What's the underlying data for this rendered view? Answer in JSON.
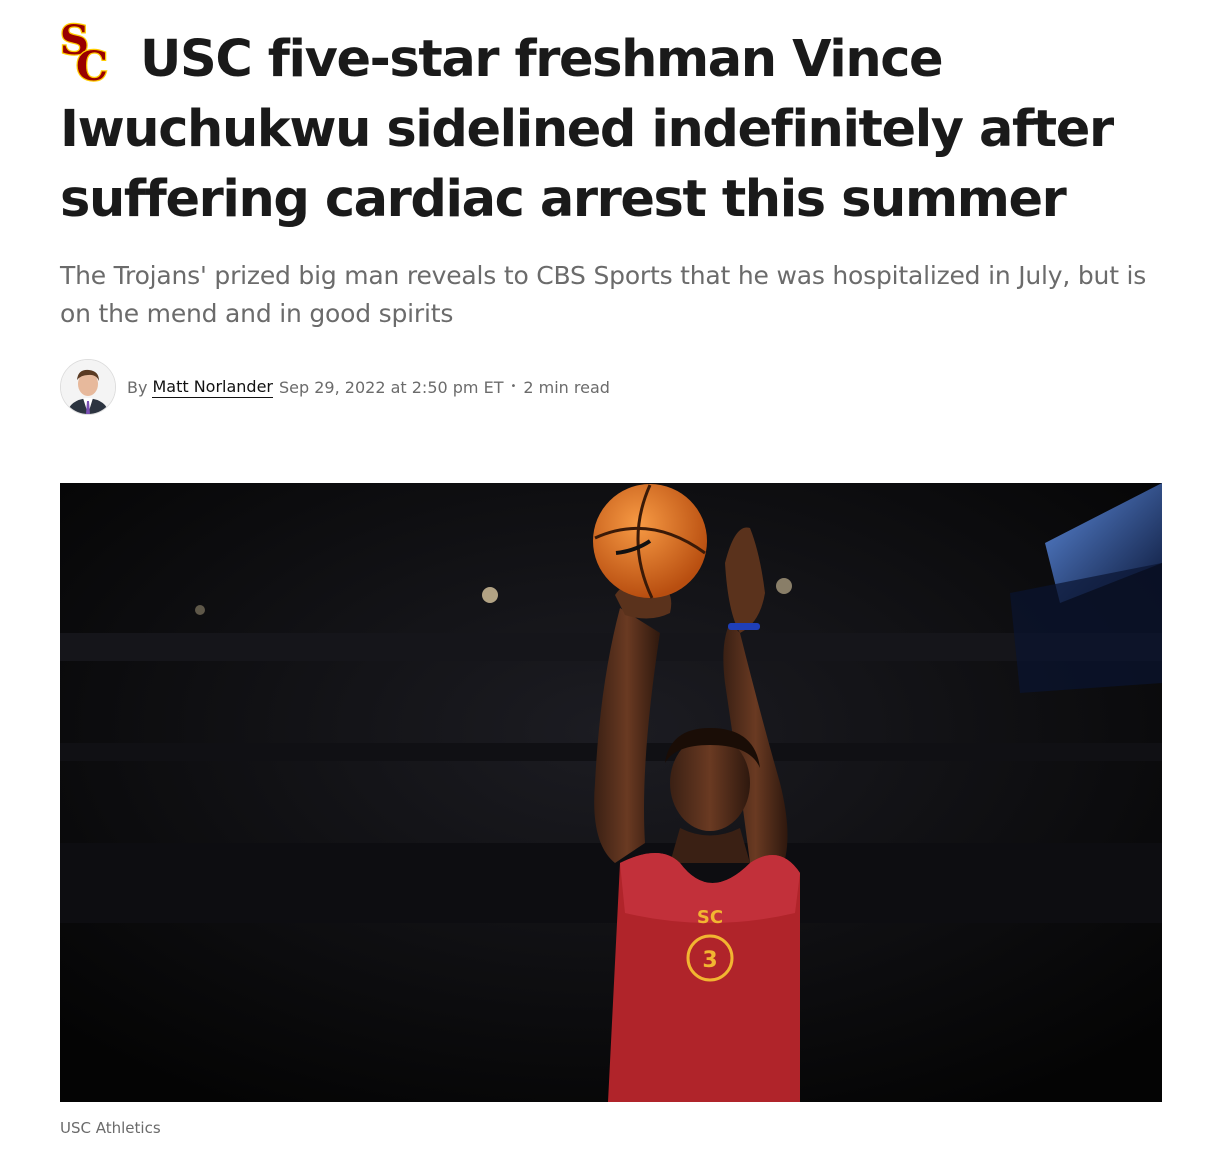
{
  "article": {
    "headline": "USC five-star freshman Vince Iwuchukwu sidelined indefinitely after suffering cardiac arrest this summer",
    "subheadline": "The Trojans' prized big man reveals to CBS Sports that he was hospitalized in July, but is on the mend and in good spirits",
    "team_logo_icon": "usc-sc-logo",
    "byline": {
      "by_label": "By",
      "author": "Matt Norlander",
      "date": "Sep 29, 2022 at 2:50 pm ET",
      "separator": "•",
      "read_time": "2 min read"
    },
    "hero_image": {
      "description_icon": "basketball-player-photo",
      "caption": "USC Athletics"
    }
  },
  "colors": {
    "usc_cardinal": "#990000",
    "usc_gold": "#FFCC00",
    "headline": "#1a1a1a",
    "meta_text": "#6b6b6b"
  }
}
